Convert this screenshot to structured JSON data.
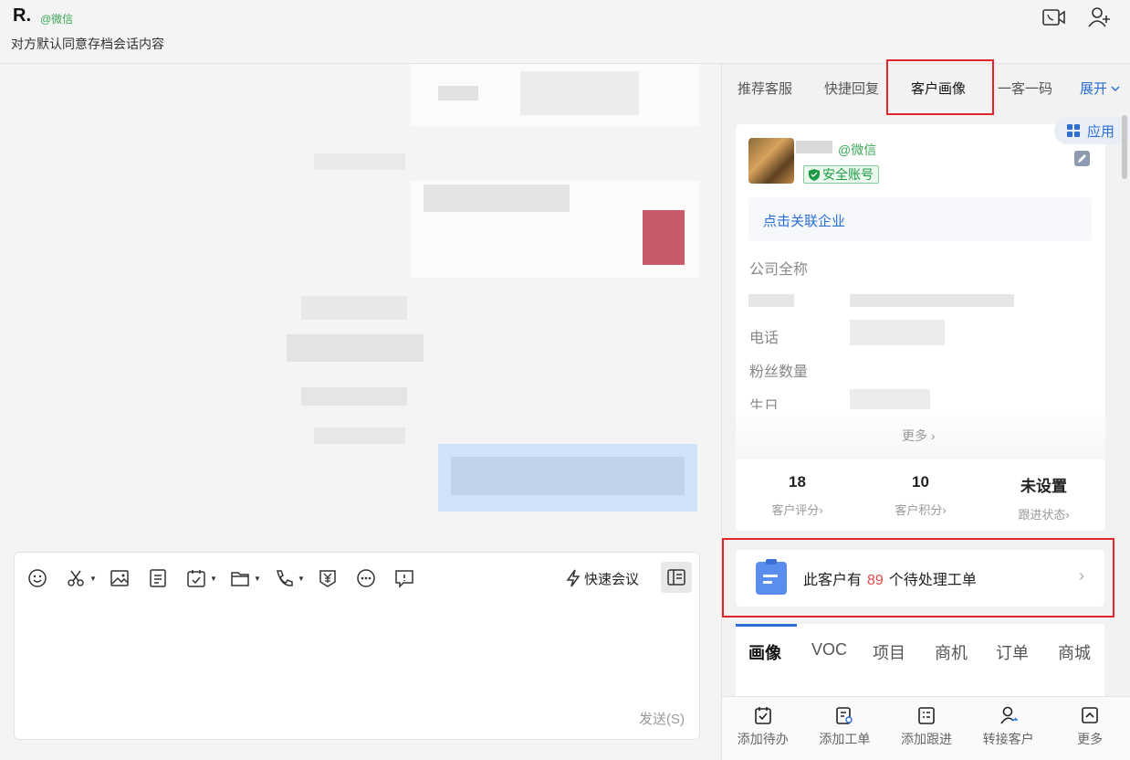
{
  "header": {
    "contact_name": "R.",
    "contact_source": "@微信",
    "archive_note": "对方默认同意存档会话内容",
    "icons": [
      "video-call-icon",
      "add-member-icon"
    ]
  },
  "composer": {
    "quick_meeting": "快速会议",
    "send": "发送(S)",
    "toolbar_icons": [
      "emoji-icon",
      "screenshot-icon",
      "image-icon",
      "document-icon",
      "schedule-icon",
      "folder-icon",
      "phone-icon",
      "payment-icon",
      "more-icon",
      "feedback-icon"
    ]
  },
  "right_panel": {
    "tabs": [
      "推荐客服",
      "快捷回复",
      "客户画像",
      "一客一码"
    ],
    "active_tab": "客户画像",
    "expand": "展开",
    "apps": "应用",
    "profile": {
      "wechat_tag": "@微信",
      "safe_badge": "安全账号",
      "link_corp": "点击关联企业",
      "fields": [
        "公司全称",
        "电话",
        "粉丝数量",
        "生日"
      ],
      "more": "更多"
    },
    "stats": [
      {
        "value": "18",
        "label": "客户评分"
      },
      {
        "value": "10",
        "label": "客户积分"
      },
      {
        "value": "未设置",
        "label": "跟进状态"
      }
    ],
    "ticket": {
      "prefix": "此客户有",
      "count": "89",
      "suffix": "个待处理工单"
    },
    "sub_tabs": [
      "画像",
      "VOC",
      "项目",
      "商机",
      "订单",
      "商城"
    ],
    "active_sub_tab": "画像",
    "actions": [
      "添加待办",
      "添加工单",
      "添加跟进",
      "转接客户",
      "更多"
    ]
  },
  "colors": {
    "accent": "#2b6fd6",
    "highlight_box": "#e4242a",
    "wechat_green": "#3aa757"
  }
}
